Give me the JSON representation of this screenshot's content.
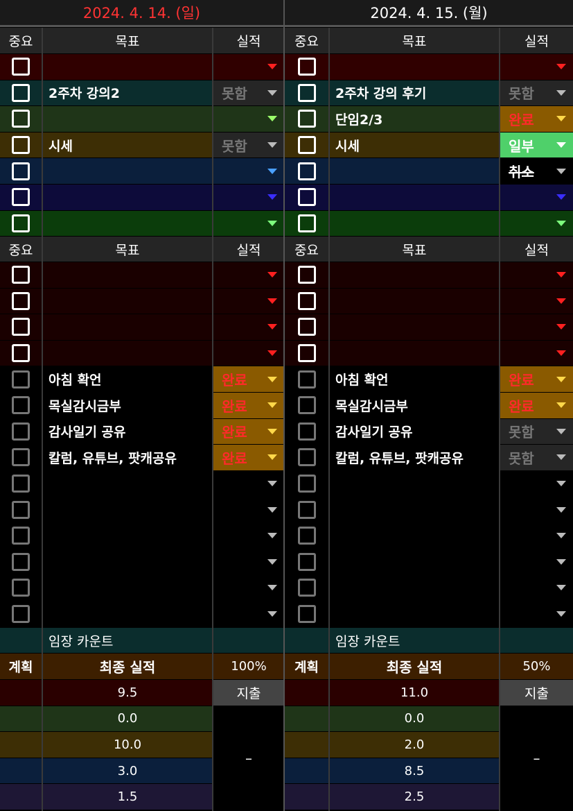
{
  "days": [
    {
      "date": "2024. 4. 14. (일)",
      "date_color": "#ff3333",
      "header": {
        "importance": "중요",
        "goal": "목표",
        "result": "실적"
      },
      "top_goals": [
        {
          "text": "",
          "status": "",
          "goal_bg": "#300000",
          "result_bg": "#300000",
          "arrow": "#ff2020",
          "status_color": ""
        },
        {
          "text": "2주차 강의2",
          "status": "못함",
          "goal_bg": "#0b2d2d",
          "result_bg": "#262626",
          "arrow": "#bbbbbb",
          "status_color": "#777777"
        },
        {
          "text": "",
          "status": "",
          "goal_bg": "#1f3518",
          "result_bg": "#1f3518",
          "arrow": "#9bff6a",
          "status_color": ""
        },
        {
          "text": "시세",
          "status": "못함",
          "goal_bg": "#3d2e05",
          "result_bg": "#262626",
          "arrow": "#bbbbbb",
          "status_color": "#777777"
        },
        {
          "text": "",
          "status": "",
          "goal_bg": "#0b1f3c",
          "result_bg": "#0b1f3c",
          "arrow": "#4aa0ff",
          "status_color": ""
        },
        {
          "text": "",
          "status": "",
          "goal_bg": "#0d0b3a",
          "result_bg": "#0d0b3a",
          "arrow": "#3a2dff",
          "status_color": ""
        },
        {
          "text": "",
          "status": "",
          "goal_bg": "#0b3d0b",
          "result_bg": "#0b3d0b",
          "arrow": "#7dff7d",
          "status_color": ""
        }
      ],
      "routine_goals": [
        {
          "text": "",
          "status": "",
          "bg": "#1a0000",
          "result_bg": "#1a0000",
          "arrow": "#ff2020",
          "dim": false
        },
        {
          "text": "",
          "status": "",
          "bg": "#1a0000",
          "result_bg": "#1a0000",
          "arrow": "#ff2020",
          "dim": false
        },
        {
          "text": "",
          "status": "",
          "bg": "#1a0000",
          "result_bg": "#1a0000",
          "arrow": "#ff2020",
          "dim": false
        },
        {
          "text": "",
          "status": "",
          "bg": "#1a0000",
          "result_bg": "#1a0000",
          "arrow": "#ff2020",
          "dim": false
        },
        {
          "text": "아침 확언",
          "status": "완료",
          "bg": "#000000",
          "result_bg": "#8a5a00",
          "arrow": "#ffd84a",
          "status_color": "#ff2a2a",
          "dim": true
        },
        {
          "text": "목실감시금부",
          "status": "완료",
          "bg": "#000000",
          "result_bg": "#8a5a00",
          "arrow": "#ffd84a",
          "status_color": "#ff2a2a",
          "dim": true
        },
        {
          "text": "감사일기 공유",
          "status": "완료",
          "bg": "#000000",
          "result_bg": "#8a5a00",
          "arrow": "#ffd84a",
          "status_color": "#ff2a2a",
          "dim": true
        },
        {
          "text": "칼럼, 유튜브, 팟캐공유",
          "status": "완료",
          "bg": "#000000",
          "result_bg": "#8a5a00",
          "arrow": "#ffd84a",
          "status_color": "#ff2a2a",
          "dim": true
        },
        {
          "text": "",
          "status": "",
          "bg": "#000000",
          "result_bg": "#000000",
          "arrow": "#bbbbbb",
          "dim": true
        },
        {
          "text": "",
          "status": "",
          "bg": "#000000",
          "result_bg": "#000000",
          "arrow": "#bbbbbb",
          "dim": true
        },
        {
          "text": "",
          "status": "",
          "bg": "#000000",
          "result_bg": "#000000",
          "arrow": "#bbbbbb",
          "dim": true
        },
        {
          "text": "",
          "status": "",
          "bg": "#000000",
          "result_bg": "#000000",
          "arrow": "#bbbbbb",
          "dim": true
        },
        {
          "text": "",
          "status": "",
          "bg": "#000000",
          "result_bg": "#000000",
          "arrow": "#bbbbbb",
          "dim": true
        },
        {
          "text": "",
          "status": "",
          "bg": "#000000",
          "result_bg": "#000000",
          "arrow": "#bbbbbb",
          "dim": true
        }
      ],
      "count_label": "임장 카운트",
      "summary": {
        "plan": "계획",
        "final": "최종 실적",
        "percent": "100%",
        "expense": "지출",
        "expense_value": "–"
      },
      "plans": [
        {
          "value": "9.5",
          "bg": "#2a0000"
        },
        {
          "value": "0.0",
          "bg": "#1f3518"
        },
        {
          "value": "10.0",
          "bg": "#3d2e05"
        },
        {
          "value": "3.0",
          "bg": "#0b1f3c"
        },
        {
          "value": "1.5",
          "bg": "#1e1735"
        }
      ]
    },
    {
      "date": "2024. 4. 15. (월)",
      "date_color": "#ffffff",
      "header": {
        "importance": "중요",
        "goal": "목표",
        "result": "실적"
      },
      "top_goals": [
        {
          "text": "",
          "status": "",
          "goal_bg": "#300000",
          "result_bg": "#300000",
          "arrow": "#ff2020",
          "status_color": ""
        },
        {
          "text": "2주차 강의 후기",
          "status": "못함",
          "goal_bg": "#0b2d2d",
          "result_bg": "#262626",
          "arrow": "#bbbbbb",
          "status_color": "#777777"
        },
        {
          "text": "단임2/3",
          "status": "완료",
          "goal_bg": "#1f3518",
          "result_bg": "#8a5a00",
          "arrow": "#ffd84a",
          "status_color": "#ff2a2a"
        },
        {
          "text": "시세",
          "status": "일부",
          "goal_bg": "#3d2e05",
          "result_bg": "#4fd06a",
          "arrow": "#ffffff",
          "status_color": "#ffffff"
        },
        {
          "text": "",
          "status": "취소",
          "goal_bg": "#0b1f3c",
          "result_bg": "#000000",
          "arrow": "#bbbbbb",
          "status_color": "#ffffff",
          "strike": true
        },
        {
          "text": "",
          "status": "",
          "goal_bg": "#0d0b3a",
          "result_bg": "#0d0b3a",
          "arrow": "#3a2dff",
          "status_color": ""
        },
        {
          "text": "",
          "status": "",
          "goal_bg": "#0b3d0b",
          "result_bg": "#0b3d0b",
          "arrow": "#7dff7d",
          "status_color": ""
        }
      ],
      "routine_goals": [
        {
          "text": "",
          "status": "",
          "bg": "#1a0000",
          "result_bg": "#1a0000",
          "arrow": "#ff2020",
          "dim": false
        },
        {
          "text": "",
          "status": "",
          "bg": "#1a0000",
          "result_bg": "#1a0000",
          "arrow": "#ff2020",
          "dim": false
        },
        {
          "text": "",
          "status": "",
          "bg": "#1a0000",
          "result_bg": "#1a0000",
          "arrow": "#ff2020",
          "dim": false
        },
        {
          "text": "",
          "status": "",
          "bg": "#1a0000",
          "result_bg": "#1a0000",
          "arrow": "#ff2020",
          "dim": false
        },
        {
          "text": "아침 확언",
          "status": "완료",
          "bg": "#000000",
          "result_bg": "#8a5a00",
          "arrow": "#ffd84a",
          "status_color": "#ff2a2a",
          "dim": true
        },
        {
          "text": "목실감시금부",
          "status": "완료",
          "bg": "#000000",
          "result_bg": "#8a5a00",
          "arrow": "#ffd84a",
          "status_color": "#ff2a2a",
          "dim": true
        },
        {
          "text": "감사일기 공유",
          "status": "못함",
          "bg": "#000000",
          "result_bg": "#262626",
          "arrow": "#bbbbbb",
          "status_color": "#777777",
          "dim": true
        },
        {
          "text": "칼럼, 유튜브, 팟캐공유",
          "status": "못함",
          "bg": "#000000",
          "result_bg": "#262626",
          "arrow": "#bbbbbb",
          "status_color": "#777777",
          "dim": true
        },
        {
          "text": "",
          "status": "",
          "bg": "#000000",
          "result_bg": "#000000",
          "arrow": "#bbbbbb",
          "dim": true
        },
        {
          "text": "",
          "status": "",
          "bg": "#000000",
          "result_bg": "#000000",
          "arrow": "#bbbbbb",
          "dim": true
        },
        {
          "text": "",
          "status": "",
          "bg": "#000000",
          "result_bg": "#000000",
          "arrow": "#bbbbbb",
          "dim": true
        },
        {
          "text": "",
          "status": "",
          "bg": "#000000",
          "result_bg": "#000000",
          "arrow": "#bbbbbb",
          "dim": true
        },
        {
          "text": "",
          "status": "",
          "bg": "#000000",
          "result_bg": "#000000",
          "arrow": "#bbbbbb",
          "dim": true
        },
        {
          "text": "",
          "status": "",
          "bg": "#000000",
          "result_bg": "#000000",
          "arrow": "#bbbbbb",
          "dim": true
        }
      ],
      "count_label": "임장 카운트",
      "summary": {
        "plan": "계획",
        "final": "최종 실적",
        "percent": "50%",
        "expense": "지출",
        "expense_value": "–"
      },
      "plans": [
        {
          "value": "11.0",
          "bg": "#2a0000"
        },
        {
          "value": "0.0",
          "bg": "#1f3518"
        },
        {
          "value": "2.0",
          "bg": "#3d2e05"
        },
        {
          "value": "8.5",
          "bg": "#0b1f3c"
        },
        {
          "value": "2.5",
          "bg": "#1e1735"
        }
      ]
    }
  ],
  "colors": {
    "header_bg": "#252525",
    "count_bg": "#0b2d2d",
    "summary_bg": "#3d1f00",
    "expense_btn_bg": "#444444",
    "date_bar_bg": "#1a1a1a",
    "grid": "#3a3a3a"
  }
}
